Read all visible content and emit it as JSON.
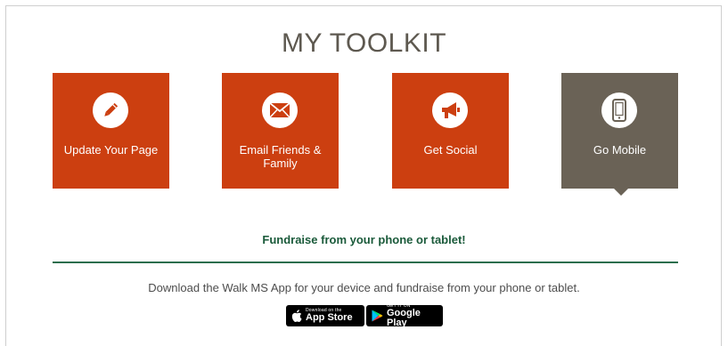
{
  "title": "MY TOOLKIT",
  "tiles": [
    {
      "label": "Update Your Page",
      "icon": "pencil-icon"
    },
    {
      "label": "Email Friends & Family",
      "icon": "envelope-icon"
    },
    {
      "label": "Get Social",
      "icon": "megaphone-icon"
    },
    {
      "label": "Go Mobile",
      "icon": "mobile-phone-icon",
      "active": true
    }
  ],
  "mobile": {
    "heading": "Fundraise from your phone or tablet!",
    "description": "Download the Walk MS App for your device and fundraise from your phone or tablet.",
    "app_store": {
      "small": "Download on the",
      "big": "App Store",
      "icon": "apple-icon"
    },
    "google_play": {
      "small": "GET IT ON",
      "big": "Google Play",
      "icon": "google-play-icon"
    }
  },
  "colors": {
    "tile_orange": "#cc3f10",
    "tile_active": "#6a6256",
    "heading_green": "#1a5a3a",
    "title_gray": "#5e5950"
  }
}
